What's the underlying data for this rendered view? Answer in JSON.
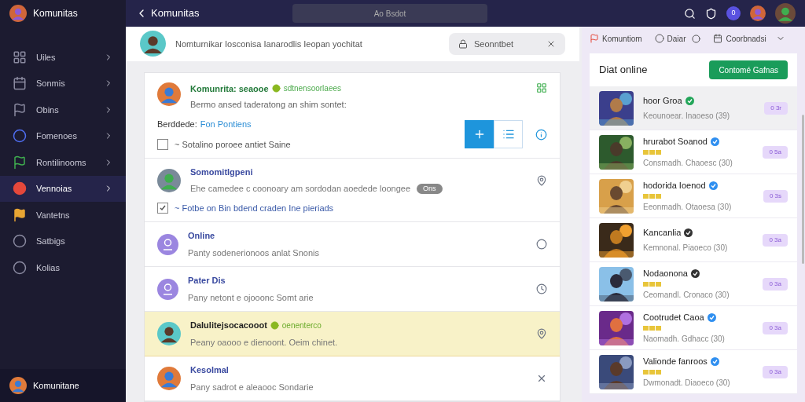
{
  "sidebar": {
    "title": "Komunitas",
    "items": [
      {
        "label": "Uiles",
        "has_submenu": true,
        "selected": false,
        "color": "#8a8aa0"
      },
      {
        "label": "Sonmis",
        "has_submenu": true,
        "selected": false,
        "color": "#8a8aa0"
      },
      {
        "label": "Obins",
        "has_submenu": true,
        "selected": false,
        "color": "#8a8aa0"
      },
      {
        "label": "Fomenoes",
        "has_submenu": true,
        "selected": false,
        "color": "#4f6ef0"
      },
      {
        "label": "Rontilinooms",
        "has_submenu": true,
        "selected": false,
        "color": "#3fae4f"
      },
      {
        "label": "Vennoias",
        "has_submenu": true,
        "selected": true,
        "color": "#e5483b"
      },
      {
        "label": "Vantetns",
        "has_submenu": false,
        "selected": false,
        "color": "#e8a533"
      },
      {
        "label": "Satbigs",
        "has_submenu": false,
        "selected": false,
        "color": "#8a8aa0"
      },
      {
        "label": "Kolias",
        "has_submenu": false,
        "selected": false,
        "color": "#8a8aa0"
      }
    ],
    "footer": "Komunitane"
  },
  "topbar": {
    "title": "Komunitas",
    "search": {
      "placeholder": "Ao Bsdot"
    },
    "notification_count": "0"
  },
  "composer": {
    "prompt": "Nomturnikar Iosconisa Ianarodlis Ieopan yochitat",
    "chip": "Seonntbet"
  },
  "feed": {
    "first": {
      "title": "Komunrita: seaooe",
      "tag": "sdtnensoorlaees",
      "text": "Bermo ansed taderatong an shim sontet:",
      "field_label": "Berddede:",
      "field_link": "Fon Pontiens",
      "check": {
        "label": "~ Sotalino poroee antiet Saine",
        "checked": false
      },
      "view_buttons": [
        {
          "kind": "add",
          "selected": true
        },
        {
          "kind": "list",
          "selected": false
        }
      ]
    },
    "rows": [
      {
        "kind": "avatar",
        "title": "Somomitlgpeni",
        "text": "Ehe camedee c coonoary am sordodan aoedede loongee",
        "chip": "Ons",
        "check": {
          "label": "~ Fotbe on Bin bdend craden Ine pieriads",
          "checked": true
        },
        "action": {
          "kind": "pin"
        },
        "highlighted": false
      },
      {
        "kind": "icon",
        "title": "Online",
        "text": "Panty sodenerionoos anlat Snonis",
        "action": {
          "kind": "circle"
        },
        "highlighted": false
      },
      {
        "kind": "icon",
        "title": "Pater Dis",
        "text": "Pany netont e ojooonc Somt arie",
        "action": {
          "kind": "clock"
        },
        "highlighted": false
      },
      {
        "kind": "avatar",
        "title": "Dalulitejsocacooot",
        "tag": "oenenterco",
        "text": "Peany oaooo e dienoont. Oeim chinet.",
        "action": {
          "kind": "pin"
        },
        "highlighted": true
      },
      {
        "kind": "avatar",
        "title": "Kesolmal",
        "text": "Pany sadrot e aleaooc Sondarie",
        "action": {
          "kind": "close"
        },
        "highlighted": false
      }
    ]
  },
  "right_panel": {
    "tabs": [
      {
        "label": "Komuntiom",
        "kind": "flag"
      },
      {
        "label": "Daiar",
        "kind": "circle"
      },
      {
        "label": "Coorbnadsi",
        "kind": "calendar"
      }
    ],
    "title": "Diat online",
    "button": "Contomé Gafnas",
    "rows": [
      {
        "name": "hoor Groa",
        "color": "#22a559",
        "meta": "Keounoear. Inaoeso (39)",
        "pill": "0 3r",
        "selected": true
      },
      {
        "name": "hrurabot Soanod",
        "color": "#2f8ff0",
        "stars": 3,
        "meta": "Consmadh. Chaoesc (30)",
        "pill": "0 5a",
        "selected": false
      },
      {
        "name": "hodorida Ioenod",
        "color": "#2f8ff0",
        "stars": 3,
        "meta": "Eeonmadh. Otaoesa (30)",
        "pill": "0 3s",
        "selected": false
      },
      {
        "name": "Kancanlia",
        "color": "#333333",
        "meta": "Kemnonal. Piaoeco (30)",
        "pill": "0 3a",
        "selected": false
      },
      {
        "name": "Nodaonona",
        "color": "#333333",
        "stars": 3,
        "meta": "Ceomandl. Cronaco (30)",
        "pill": "0 3a",
        "selected": false
      },
      {
        "name": "Cootrudet Caoa",
        "color": "#2f8ff0",
        "stars": 3,
        "meta": "Naomadh. Gdhacc (30)",
        "pill": "0 3a",
        "selected": false
      },
      {
        "name": "Valionde fanroos",
        "color": "#2f8ff0",
        "stars": 3,
        "meta": "Dwmonadt. Diaoeco (30)",
        "pill": "0 3a",
        "selected": false
      }
    ]
  }
}
